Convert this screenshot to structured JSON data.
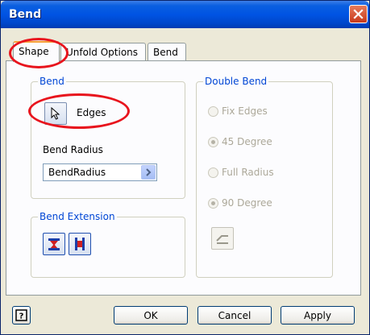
{
  "window": {
    "title": "Bend"
  },
  "tabs": [
    {
      "label": "Shape"
    },
    {
      "label": "Unfold Options"
    },
    {
      "label": "Bend"
    }
  ],
  "bend_group": {
    "label": "Bend",
    "edges_label": "Edges",
    "bend_radius_label": "Bend Radius",
    "bend_radius_value": "BendRadius"
  },
  "bend_extension_group": {
    "label": "Bend Extension"
  },
  "double_bend_group": {
    "label": "Double Bend",
    "options": [
      {
        "label": "Fix Edges",
        "selected": false
      },
      {
        "label": "45 Degree",
        "selected": true
      },
      {
        "label": "Full Radius",
        "selected": false
      },
      {
        "label": "90 Degree",
        "selected": true
      }
    ]
  },
  "buttons": {
    "ok": "OK",
    "cancel": "Cancel",
    "apply": "Apply"
  },
  "colors": {
    "title_bar": "#0054e3",
    "group_label": "#0046d5",
    "annotation": "#e8141d"
  }
}
